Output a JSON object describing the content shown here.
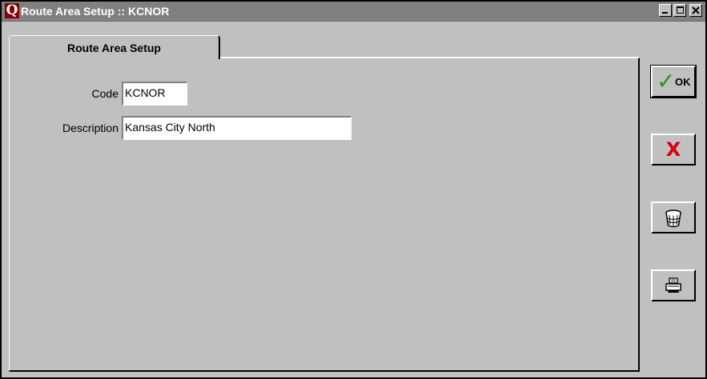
{
  "window": {
    "title": "Route Area Setup :: KCNOR",
    "logo_letter": "Q",
    "controls": [
      "minimize",
      "maximize",
      "close"
    ]
  },
  "tabs": [
    {
      "label": "Route Area Setup",
      "active": true
    }
  ],
  "form": {
    "code_label": "Code",
    "code_value": "KCNOR",
    "description_label": "Description",
    "description_value": "Kansas City North"
  },
  "side_buttons": {
    "ok_label": "OK",
    "ok_icon": "green-checkmark-icon",
    "cancel_icon": "red-x-icon",
    "cancel_glyph": "X",
    "delete_icon": "wastebasket-icon",
    "print_icon": "printer-icon"
  },
  "colors": {
    "titlebar": "#808080",
    "face": "#c0c0c0",
    "ok_check": "#1d9a1d",
    "cancel_x": "#e00000",
    "logo_bg": "#8b0000"
  }
}
